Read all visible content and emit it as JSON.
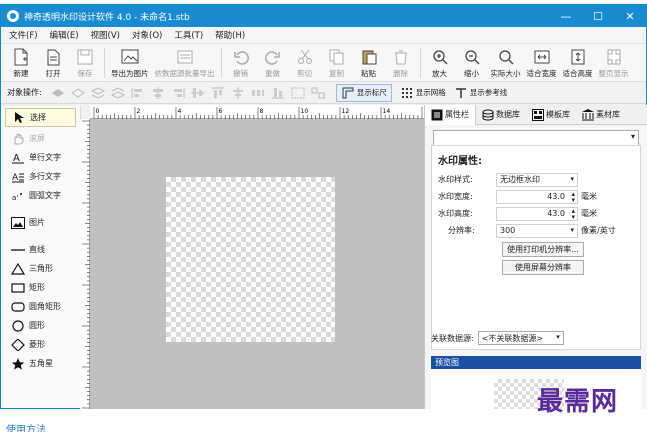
{
  "window": {
    "title": "神奇透明水印设计软件 4.0 - 未命名1.stb",
    "controls": {
      "minimize": "—",
      "maximize": "☐",
      "close": "✕"
    }
  },
  "menu": [
    "文件(F)",
    "编辑(E)",
    "视图(V)",
    "对象(O)",
    "工具(T)",
    "帮助(H)"
  ],
  "toolbar": [
    {
      "label": "新建",
      "icon": "new-file-icon",
      "enabled": true
    },
    {
      "label": "打开",
      "icon": "open-folder-icon",
      "enabled": true
    },
    {
      "label": "保存",
      "icon": "save-icon",
      "enabled": false
    },
    {
      "label": "导出为图片",
      "icon": "export-image-icon",
      "enabled": true
    },
    {
      "label": "依数据源批量导出",
      "icon": "batch-export-icon",
      "enabled": false
    },
    {
      "label": "撤销",
      "icon": "undo-icon",
      "enabled": false
    },
    {
      "label": "重做",
      "icon": "redo-icon",
      "enabled": false
    },
    {
      "label": "剪切",
      "icon": "cut-icon",
      "enabled": false
    },
    {
      "label": "复制",
      "icon": "copy-icon",
      "enabled": false
    },
    {
      "label": "粘贴",
      "icon": "paste-icon",
      "enabled": true
    },
    {
      "label": "删除",
      "icon": "delete-icon",
      "enabled": false
    },
    {
      "label": "放大",
      "icon": "zoom-in-icon",
      "enabled": true
    },
    {
      "label": "缩小",
      "icon": "zoom-out-icon",
      "enabled": true
    },
    {
      "label": "实际大小",
      "icon": "actual-size-icon",
      "enabled": true
    },
    {
      "label": "适合宽度",
      "icon": "fit-width-icon",
      "enabled": true
    },
    {
      "label": "适合高度",
      "icon": "fit-height-icon",
      "enabled": true
    },
    {
      "label": "整页显示",
      "icon": "full-page-icon",
      "enabled": false
    }
  ],
  "object_bar": {
    "label": "对象操作:",
    "show_ruler": "显示标尺",
    "show_grid": "显示网格",
    "show_guides": "显示参考线"
  },
  "tools": [
    {
      "label": "选择",
      "icon": "arrow-pointer-icon",
      "selected": true,
      "enabled": true
    },
    {
      "label": "滚屏",
      "icon": "hand-icon",
      "selected": false,
      "enabled": false
    },
    {
      "label": "单行文字",
      "icon": "single-line-text-icon",
      "selected": false,
      "enabled": true
    },
    {
      "label": "多行文字",
      "icon": "multi-line-text-icon",
      "selected": false,
      "enabled": true
    },
    {
      "label": "圆弧文字",
      "icon": "arc-text-icon",
      "selected": false,
      "enabled": true
    },
    {
      "label": "图片",
      "icon": "image-icon",
      "selected": false,
      "enabled": true
    },
    {
      "label": "直线",
      "icon": "line-icon",
      "selected": false,
      "enabled": true
    },
    {
      "label": "三角形",
      "icon": "triangle-icon",
      "selected": false,
      "enabled": true
    },
    {
      "label": "矩形",
      "icon": "rectangle-icon",
      "selected": false,
      "enabled": true
    },
    {
      "label": "圆角矩形",
      "icon": "rounded-rectangle-icon",
      "selected": false,
      "enabled": true
    },
    {
      "label": "圆形",
      "icon": "circle-icon",
      "selected": false,
      "enabled": true
    },
    {
      "label": "菱形",
      "icon": "diamond-icon",
      "selected": false,
      "enabled": true
    },
    {
      "label": "五角星",
      "icon": "star-icon",
      "selected": false,
      "enabled": true
    }
  ],
  "ruler": {
    "h_ticks": [
      "0",
      "2",
      "4",
      "6",
      "8",
      "10",
      "12",
      "14",
      "16"
    ]
  },
  "panel": {
    "tabs": [
      "属性栏",
      "数据库",
      "模板库",
      "素材库"
    ],
    "heading": "水印属性:",
    "style": {
      "label": "水印样式:",
      "value": "无边框水印"
    },
    "width": {
      "label": "水印宽度:",
      "value": "43.0",
      "unit": "毫米"
    },
    "height": {
      "label": "水印高度:",
      "value": "43.0",
      "unit": "毫米"
    },
    "resolution": {
      "label": "分辨率:",
      "value": "300",
      "unit": "像素/英寸"
    },
    "btn_printer": "使用打印机分辨率...",
    "btn_screen": "使用屏幕分辨率",
    "datasource": {
      "label": "关联数据源:",
      "value": "<不关联数据源>"
    },
    "preview_title": "预览图"
  },
  "watermark_text": "最需网",
  "bottom_link": "使用方法",
  "top_caption": "",
  "colors": {
    "titlebar": "#1a8bd0",
    "preview_bar": "#1b4fa0",
    "watermark": "#5a2a9c",
    "canvas": "#c0c0c0"
  }
}
